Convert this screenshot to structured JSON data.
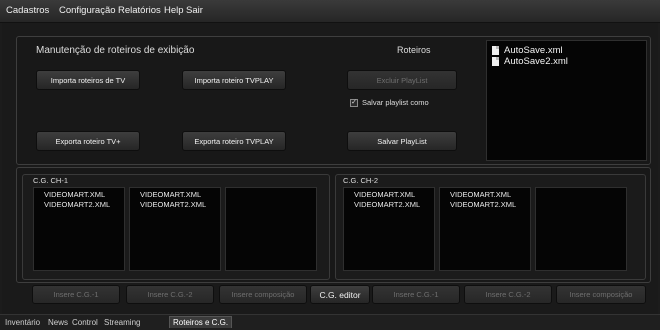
{
  "menu": [
    "Cadastros",
    "Configuração",
    "Relatórios",
    "Help",
    "Sair"
  ],
  "top_panel": {
    "title": "Manutenção de roteiros de exibição",
    "roteiros_label": "Roteiros",
    "buttons": {
      "importa_tv": "Importa roteiros de TV",
      "importa_tvplay": "Importa roteiro TVPLAY",
      "excluir_playlist": "Excluir PlayList",
      "exporta_tv": "Exporta roteiro TV+",
      "exporta_tvplay": "Exporta roteiro TVPLAY",
      "salvar_playlist": "Salvar PlayList"
    },
    "checkbox_label": "Salvar playlist como",
    "checkbox_checked": true,
    "files": [
      "AutoSave.xml",
      "AutoSave2.xml"
    ]
  },
  "cg": {
    "ch1_label": "C.G. CH-1",
    "ch2_label": "C.G. CH-2",
    "ch1_lists": [
      [
        "VIDEOMART.XML",
        "VIDEOMART2.XML"
      ],
      [
        "VIDEOMART.XML",
        "VIDEOMART2.XML"
      ],
      []
    ],
    "ch2_lists": [
      [
        "VIDEOMART.XML",
        "VIDEOMART2.XML"
      ],
      [
        "VIDEOMART.XML",
        "VIDEOMART2.XML"
      ],
      []
    ]
  },
  "bottom_buttons": {
    "insere_cg1_a": "Insere C.G.-1",
    "insere_cg2_a": "Insere C.G.-2",
    "insere_comp_a": "Insere composição",
    "cg_editor": "C.G. editor",
    "insere_cg1_b": "Insere C.G.-1",
    "insere_cg2_b": "Insere C.G.-2",
    "insere_comp_b": "Insere composição"
  },
  "tabs": [
    "Inventário",
    "News",
    "Control",
    "Streaming",
    "Roteiros e C.G."
  ],
  "active_tab": "Roteiros e C.G."
}
